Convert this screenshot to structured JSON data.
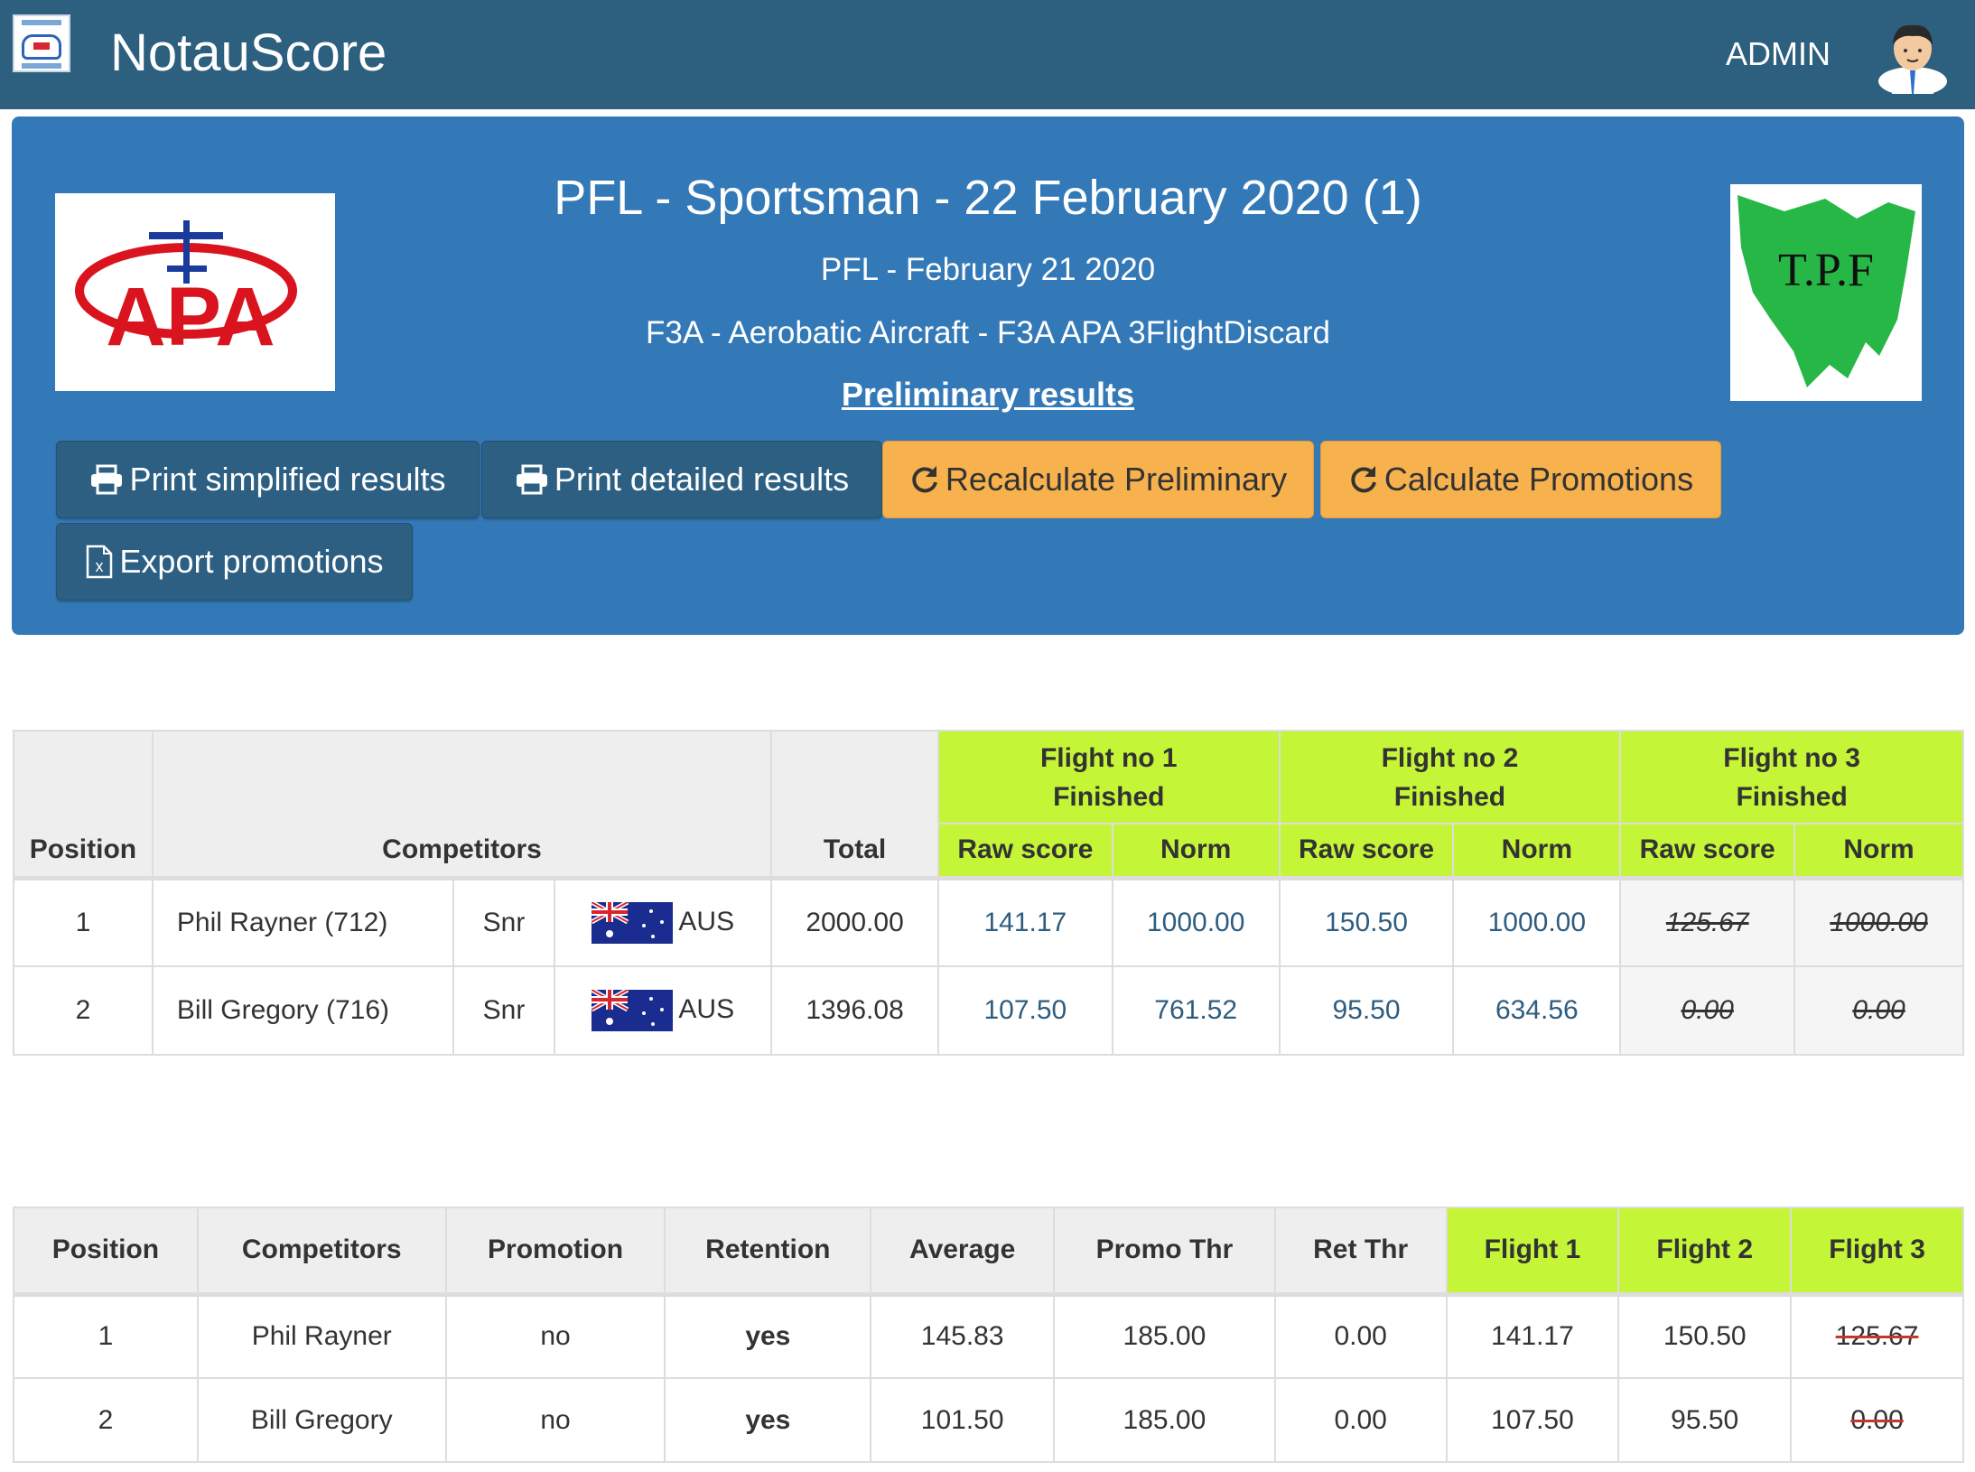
{
  "navbar": {
    "brand": "NotauScore",
    "user_label": "ADMIN"
  },
  "header": {
    "title": "PFL - Sportsman - 22 February 2020 (1)",
    "subtitle": "PFL - February 21 2020",
    "category": "F3A - Aerobatic Aircraft - F3A APA 3FlightDiscard",
    "results_link": "Preliminary results",
    "logo_left_text": "APA",
    "logo_right_text": "T.P.F"
  },
  "buttons": {
    "print_simplified": "Print simplified results",
    "print_detailed": "Print detailed results",
    "recalculate": "Recalculate Preliminary",
    "calc_promotions": "Calculate Promotions",
    "export_promotions": "Export promotions"
  },
  "results": {
    "headers": {
      "position": "Position",
      "competitors": "Competitors",
      "total": "Total",
      "raw": "Raw score",
      "norm": "Norm"
    },
    "flights": [
      {
        "name": "Flight no 1",
        "status": "Finished"
      },
      {
        "name": "Flight no 2",
        "status": "Finished"
      },
      {
        "name": "Flight no 3",
        "status": "Finished"
      }
    ],
    "rows": [
      {
        "position": "1",
        "name": "Phil Rayner (712)",
        "class": "Snr",
        "country": "AUS",
        "total": "2000.00",
        "f1_raw": "141.17",
        "f1_norm": "1000.00",
        "f2_raw": "150.50",
        "f2_norm": "1000.00",
        "f3_raw": "125.67",
        "f3_norm": "1000.00"
      },
      {
        "position": "2",
        "name": "Bill Gregory (716)",
        "class": "Snr",
        "country": "AUS",
        "total": "1396.08",
        "f1_raw": "107.50",
        "f1_norm": "761.52",
        "f2_raw": "95.50",
        "f2_norm": "634.56",
        "f3_raw": "0.00",
        "f3_norm": "0.00"
      }
    ]
  },
  "promotions": {
    "headers": {
      "position": "Position",
      "competitors": "Competitors",
      "promotion": "Promotion",
      "retention": "Retention",
      "average": "Average",
      "promo_thr": "Promo Thr",
      "ret_thr": "Ret Thr",
      "flight1": "Flight 1",
      "flight2": "Flight 2",
      "flight3": "Flight 3"
    },
    "rows": [
      {
        "position": "1",
        "name": "Phil Rayner",
        "promotion": "no",
        "retention": "yes",
        "average": "145.83",
        "promo_thr": "185.00",
        "ret_thr": "0.00",
        "f1": "141.17",
        "f2": "150.50",
        "f3": "125.67"
      },
      {
        "position": "2",
        "name": "Bill Gregory",
        "promotion": "no",
        "retention": "yes",
        "average": "101.50",
        "promo_thr": "185.00",
        "ret_thr": "0.00",
        "f1": "107.50",
        "f2": "95.50",
        "f3": "0.00"
      }
    ]
  }
}
